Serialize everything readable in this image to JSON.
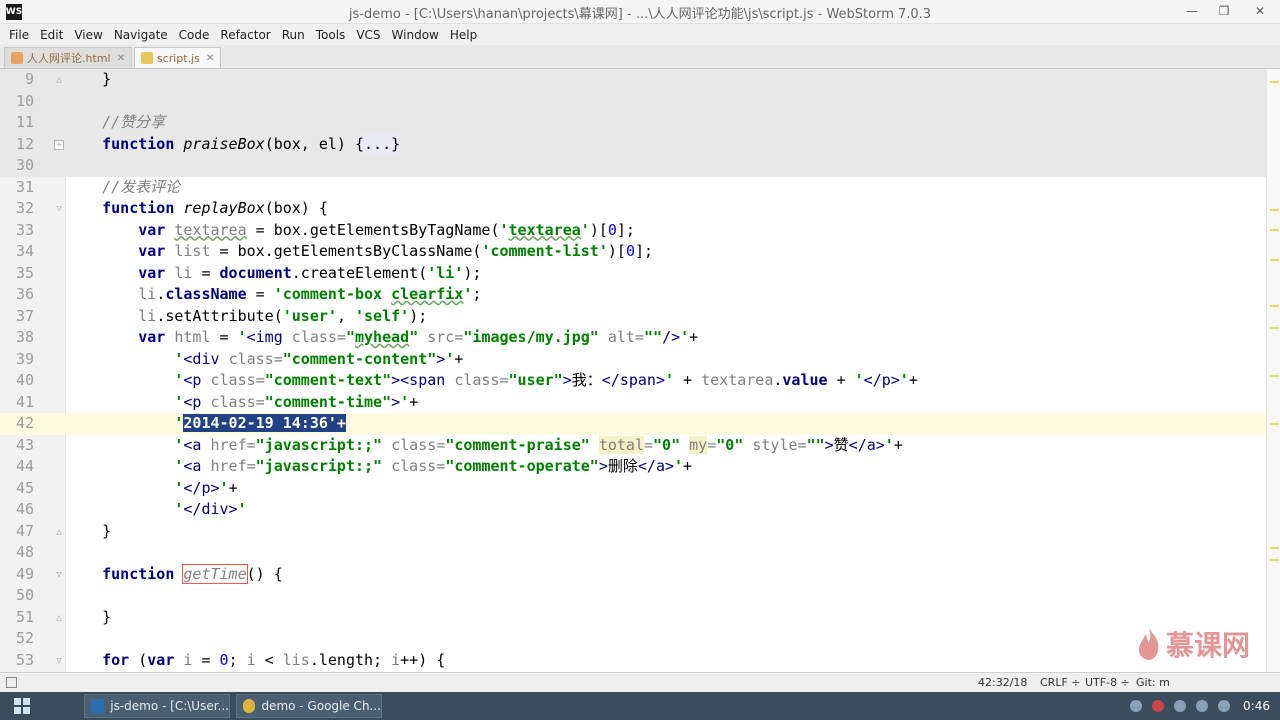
{
  "window": {
    "title": "js-demo - [C:\\Users\\hanan\\projects\\幕课网] - ...\\人人网评论功能\\js\\script.js - WebStorm 7.0.3"
  },
  "menu": [
    "File",
    "Edit",
    "View",
    "Navigate",
    "Code",
    "Refactor",
    "Run",
    "Tools",
    "VCS",
    "Window",
    "Help"
  ],
  "tabs": [
    {
      "label": "人人网评论.html",
      "icon": "html-file-icon"
    },
    {
      "label": "script.js",
      "icon": "js-file-icon"
    }
  ],
  "editor": {
    "current_line": "42",
    "selected_text": "2014-02-19 14:36'+",
    "lines": [
      {
        "n": "9",
        "text": "    }"
      },
      {
        "n": "10",
        "text": ""
      },
      {
        "n": "11",
        "text": "    //赞分享"
      },
      {
        "n": "12",
        "text": "    function praiseBox(box, el) {...}"
      },
      {
        "n": "30",
        "text": ""
      },
      {
        "n": "31",
        "text": "    //发表评论"
      },
      {
        "n": "32",
        "text": "    function replayBox(box) {"
      },
      {
        "n": "33",
        "text": "        var textarea = box.getElementsByTagName('textarea')[0];"
      },
      {
        "n": "34",
        "text": "        var list = box.getElementsByClassName('comment-list')[0];"
      },
      {
        "n": "35",
        "text": "        var li = document.createElement('li');"
      },
      {
        "n": "36",
        "text": "        li.className = 'comment-box clearfix';"
      },
      {
        "n": "37",
        "text": "        li.setAttribute('user', 'self');"
      },
      {
        "n": "38",
        "text": "        var html = '<img class=\"myhead\" src=\"images/my.jpg\" alt=\"\"/>'+"
      },
      {
        "n": "39",
        "text": "            '<div class=\"comment-content\">'+"
      },
      {
        "n": "40",
        "text": "            '<p class=\"comment-text\"><span class=\"user\">我：</span>' + textarea.value + '</p>'+"
      },
      {
        "n": "41",
        "text": "            '<p class=\"comment-time\">'+"
      },
      {
        "n": "42",
        "text": "            '2014-02-19 14:36'+"
      },
      {
        "n": "43",
        "text": "            '<a href=\"javascript:;\" class=\"comment-praise\" total=\"0\" my=\"0\" style=\"\">赞</a>'+"
      },
      {
        "n": "44",
        "text": "            '<a href=\"javascript:;\" class=\"comment-operate\">删除</a>'+"
      },
      {
        "n": "45",
        "text": "            '</p>'+"
      },
      {
        "n": "46",
        "text": "            '</div>'"
      },
      {
        "n": "47",
        "text": "    }"
      },
      {
        "n": "48",
        "text": ""
      },
      {
        "n": "49",
        "text": "    function getTime() {"
      },
      {
        "n": "50",
        "text": ""
      },
      {
        "n": "51",
        "text": "    }"
      },
      {
        "n": "52",
        "text": ""
      },
      {
        "n": "53",
        "text": "    for (var i = 0; i < lis.length; i++) {"
      }
    ]
  },
  "status": {
    "position": "42:32/18",
    "line_sep": "CRLF ÷",
    "encoding": "UTF-8 ÷",
    "vcs": "Git: m"
  },
  "watermark": {
    "text": "慕课网"
  },
  "taskbar": {
    "items": [
      {
        "label": "js-demo - [C:\\User...",
        "icon": "webstorm-icon"
      },
      {
        "label": "demo - Google Ch...",
        "icon": "chrome-icon"
      }
    ],
    "clock": "0:46"
  },
  "colors": {
    "keyword": "#000080",
    "string": "#008000",
    "comment": "#808080",
    "selection": "#214283",
    "current_line": "#fffbe0",
    "taskbar": "#3b4c5c"
  }
}
